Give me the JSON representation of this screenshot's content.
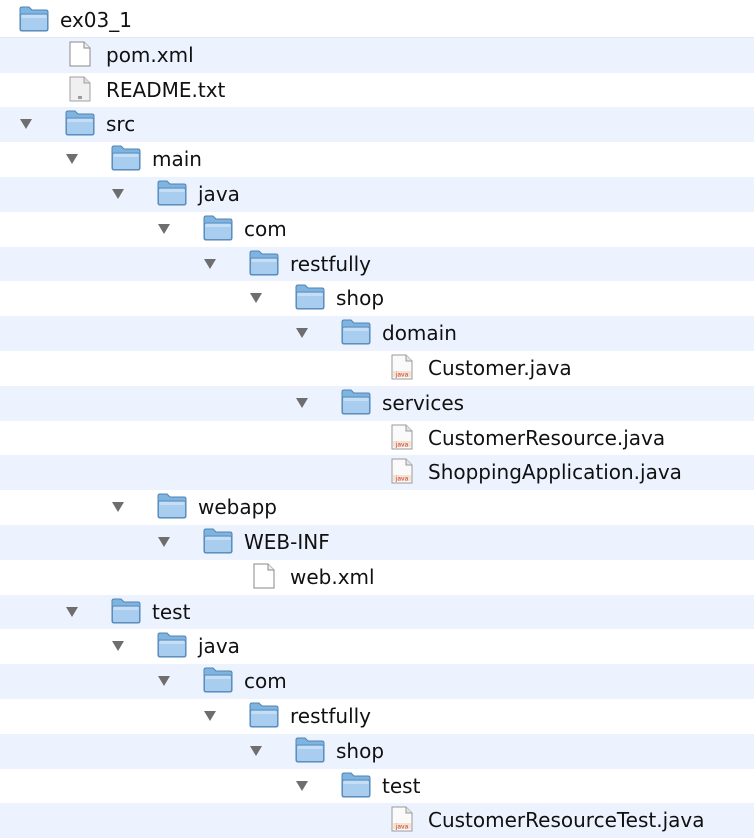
{
  "tree": {
    "items": [
      {
        "label": "ex03_1",
        "type": "folder",
        "depth": 0,
        "expanded": false,
        "has_toggle": false
      },
      {
        "label": "pom.xml",
        "type": "xml",
        "depth": 1,
        "has_toggle": false
      },
      {
        "label": "README.txt",
        "type": "txt",
        "depth": 1,
        "has_toggle": false
      },
      {
        "label": "src",
        "type": "folder",
        "depth": 1,
        "expanded": true,
        "has_toggle": true
      },
      {
        "label": "main",
        "type": "folder",
        "depth": 2,
        "expanded": true,
        "has_toggle": true
      },
      {
        "label": "java",
        "type": "folder",
        "depth": 3,
        "expanded": true,
        "has_toggle": true
      },
      {
        "label": "com",
        "type": "folder",
        "depth": 4,
        "expanded": true,
        "has_toggle": true
      },
      {
        "label": "restfully",
        "type": "folder",
        "depth": 5,
        "expanded": true,
        "has_toggle": true
      },
      {
        "label": "shop",
        "type": "folder",
        "depth": 6,
        "expanded": true,
        "has_toggle": true
      },
      {
        "label": "domain",
        "type": "folder",
        "depth": 7,
        "expanded": true,
        "has_toggle": true
      },
      {
        "label": "Customer.java",
        "type": "java",
        "depth": 8,
        "has_toggle": false
      },
      {
        "label": "services",
        "type": "folder",
        "depth": 7,
        "expanded": true,
        "has_toggle": true
      },
      {
        "label": "CustomerResource.java",
        "type": "java",
        "depth": 8,
        "has_toggle": false
      },
      {
        "label": "ShoppingApplication.java",
        "type": "java",
        "depth": 8,
        "has_toggle": false
      },
      {
        "label": "webapp",
        "type": "folder",
        "depth": 3,
        "expanded": true,
        "has_toggle": true
      },
      {
        "label": "WEB-INF",
        "type": "folder",
        "depth": 4,
        "expanded": true,
        "has_toggle": true
      },
      {
        "label": "web.xml",
        "type": "xml",
        "depth": 5,
        "has_toggle": false
      },
      {
        "label": "test",
        "type": "folder",
        "depth": 2,
        "expanded": true,
        "has_toggle": true
      },
      {
        "label": "java",
        "type": "folder",
        "depth": 3,
        "expanded": true,
        "has_toggle": true
      },
      {
        "label": "com",
        "type": "folder",
        "depth": 4,
        "expanded": true,
        "has_toggle": true
      },
      {
        "label": "restfully",
        "type": "folder",
        "depth": 5,
        "expanded": true,
        "has_toggle": true
      },
      {
        "label": "shop",
        "type": "folder",
        "depth": 6,
        "expanded": true,
        "has_toggle": true
      },
      {
        "label": "test",
        "type": "folder",
        "depth": 7,
        "expanded": true,
        "has_toggle": true
      },
      {
        "label": "CustomerResourceTest.java",
        "type": "java",
        "depth": 8,
        "has_toggle": false
      }
    ],
    "icons": {
      "folder": "folder-icon",
      "xml": "document-icon",
      "txt": "text-file-icon",
      "java": "java-file-icon"
    },
    "colors": {
      "row_alt": "#edf3fe",
      "folder_body": "#7fb3e0",
      "folder_front": "#a9cdef",
      "disclosure": "#6e6e6e",
      "java_badge": "#cc3333"
    }
  }
}
